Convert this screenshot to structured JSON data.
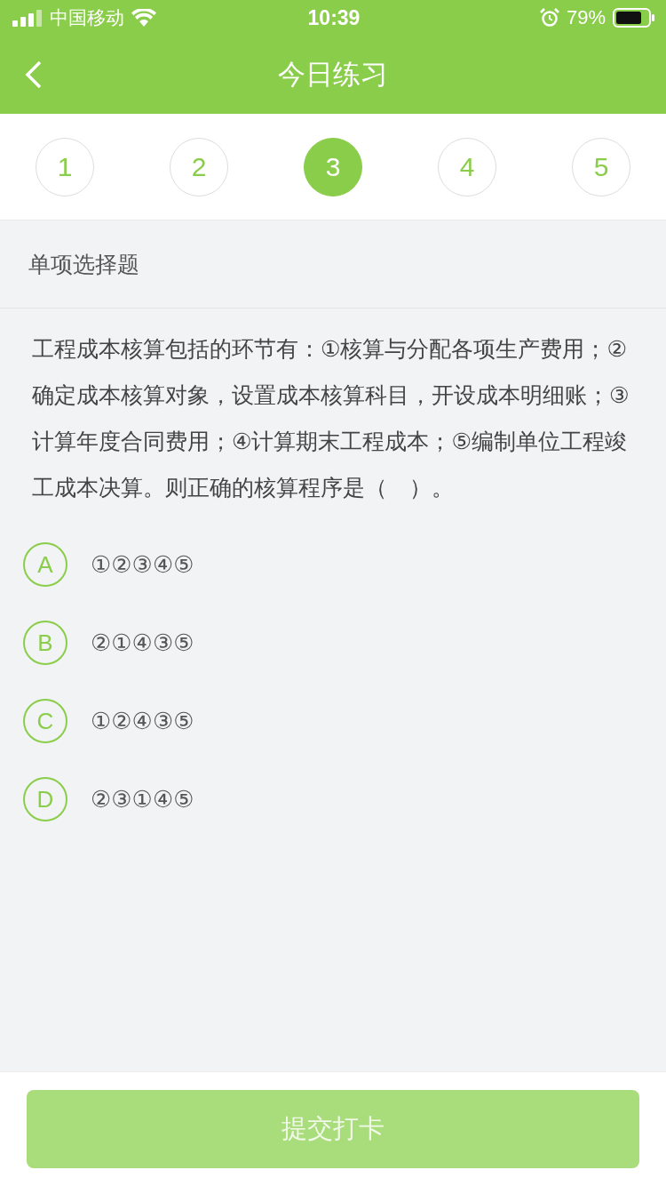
{
  "status_bar": {
    "carrier": "中国移动",
    "time": "10:39",
    "battery": "79%"
  },
  "nav": {
    "title": "今日练习"
  },
  "steps": [
    {
      "label": "1",
      "selected": false
    },
    {
      "label": "2",
      "selected": false
    },
    {
      "label": "3",
      "selected": true
    },
    {
      "label": "4",
      "selected": false
    },
    {
      "label": "5",
      "selected": false
    }
  ],
  "question": {
    "type_label": "单项选择题",
    "text": "工程成本核算包括的环节有：①核算与分配各项生产费用；②确定成本核算对象，设置成本核算科目，开设成本明细账；③计算年度合同费用；④计算期末工程成本；⑤编制单位工程竣工成本决算。则正确的核算程序是（　）。",
    "options": [
      {
        "letter": "A",
        "text": "①②③④⑤",
        "selected": false
      },
      {
        "letter": "B",
        "text": "②①④③⑤",
        "selected": false
      },
      {
        "letter": "C",
        "text": "①②④③⑤",
        "selected": false
      },
      {
        "letter": "D",
        "text": "②③①④⑤",
        "selected": false
      }
    ]
  },
  "submit_button": {
    "label": "提交打卡",
    "disabled": true
  }
}
